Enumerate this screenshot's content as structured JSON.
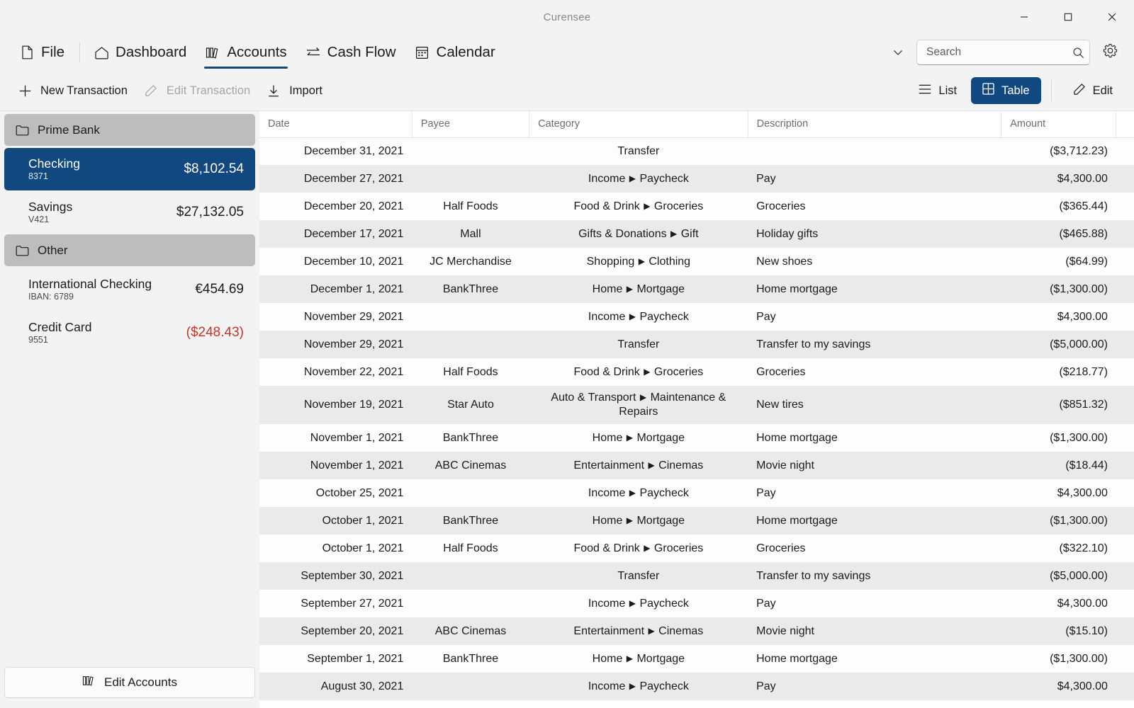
{
  "window": {
    "title": "Curensee",
    "controls": [
      {
        "name": "minimize-button",
        "label": "Minimize"
      },
      {
        "name": "maximize-button",
        "label": "Maximize"
      },
      {
        "name": "close-button",
        "label": "Close"
      }
    ]
  },
  "nav": {
    "items": [
      {
        "label": "File",
        "icon": "file-icon",
        "active": false
      },
      {
        "label": "Dashboard",
        "icon": "home-icon",
        "active": false
      },
      {
        "label": "Accounts",
        "icon": "accounts-icon",
        "active": true
      },
      {
        "label": "Cash Flow",
        "icon": "transfer-icon",
        "active": false
      },
      {
        "label": "Calendar",
        "icon": "calendar-icon",
        "active": false
      }
    ],
    "overflow_label": "More",
    "settings_label": "Settings"
  },
  "search": {
    "placeholder": "Search",
    "value": ""
  },
  "toolbar": {
    "new_transaction": "New Transaction",
    "edit_transaction": "Edit Transaction",
    "import": "Import",
    "list": "List",
    "table": "Table",
    "edit": "Edit"
  },
  "colors": {
    "accent": "#10487f",
    "negative": "#c9342a",
    "group_header_bg": "#bdbdbd",
    "row_alt_bg": "#eaeaea"
  },
  "sidebar": {
    "groups": [
      {
        "name": "Prime Bank",
        "icon": "folder-icon",
        "accounts": [
          {
            "name": "Checking",
            "number": "8371",
            "balance": "$8,102.54",
            "negative": false,
            "selected": true
          },
          {
            "name": "Savings",
            "number": "V421",
            "balance": "$27,132.05",
            "negative": false,
            "selected": false
          }
        ]
      },
      {
        "name": "Other",
        "icon": "folder-icon",
        "accounts": [
          {
            "name": "International Checking",
            "number": "IBAN: 6789",
            "balance": "€454.69",
            "negative": false,
            "selected": false
          },
          {
            "name": "Credit Card",
            "number": "9551",
            "balance": "($248.43)",
            "negative": true,
            "selected": false
          }
        ]
      }
    ],
    "edit_accounts": "Edit Accounts"
  },
  "table": {
    "columns": [
      "Date",
      "Payee",
      "Category",
      "Description",
      "Amount"
    ],
    "rows": [
      {
        "date": "December 31, 2021",
        "payee": "",
        "category": "Transfer",
        "description": "",
        "amount": "($3,712.23)"
      },
      {
        "date": "December 27, 2021",
        "payee": "",
        "category": "Income ▶ Paycheck",
        "description": "Pay",
        "amount": "$4,300.00"
      },
      {
        "date": "December 20, 2021",
        "payee": "Half Foods",
        "category": "Food & Drink ▶ Groceries",
        "description": "Groceries",
        "amount": "($365.44)"
      },
      {
        "date": "December 17, 2021",
        "payee": "Mall",
        "category": "Gifts & Donations ▶ Gift",
        "description": "Holiday gifts",
        "amount": "($465.88)"
      },
      {
        "date": "December 10, 2021",
        "payee": "JC Merchandise",
        "category": "Shopping ▶ Clothing",
        "description": "New shoes",
        "amount": "($64.99)"
      },
      {
        "date": "December 1, 2021",
        "payee": "BankThree",
        "category": "Home ▶ Mortgage",
        "description": "Home mortgage",
        "amount": "($1,300.00)"
      },
      {
        "date": "November 29, 2021",
        "payee": "",
        "category": "Income ▶ Paycheck",
        "description": "Pay",
        "amount": "$4,300.00"
      },
      {
        "date": "November 29, 2021",
        "payee": "",
        "category": "Transfer",
        "description": "Transfer to my savings",
        "amount": "($5,000.00)"
      },
      {
        "date": "November 22, 2021",
        "payee": "Half Foods",
        "category": "Food & Drink ▶ Groceries",
        "description": "Groceries",
        "amount": "($218.77)"
      },
      {
        "date": "November 19, 2021",
        "payee": "Star Auto",
        "category": "Auto & Transport ▶ Maintenance & Repairs",
        "description": "New tires",
        "amount": "($851.32)"
      },
      {
        "date": "November 1, 2021",
        "payee": "BankThree",
        "category": "Home ▶ Mortgage",
        "description": "Home mortgage",
        "amount": "($1,300.00)"
      },
      {
        "date": "November 1, 2021",
        "payee": "ABC Cinemas",
        "category": "Entertainment ▶ Cinemas",
        "description": "Movie night",
        "amount": "($18.44)"
      },
      {
        "date": "October 25, 2021",
        "payee": "",
        "category": "Income ▶ Paycheck",
        "description": "Pay",
        "amount": "$4,300.00"
      },
      {
        "date": "October 1, 2021",
        "payee": "BankThree",
        "category": "Home ▶ Mortgage",
        "description": "Home mortgage",
        "amount": "($1,300.00)"
      },
      {
        "date": "October 1, 2021",
        "payee": "Half Foods",
        "category": "Food & Drink ▶ Groceries",
        "description": "Groceries",
        "amount": "($322.10)"
      },
      {
        "date": "September 30, 2021",
        "payee": "",
        "category": "Transfer",
        "description": "Transfer to my savings",
        "amount": "($5,000.00)"
      },
      {
        "date": "September 27, 2021",
        "payee": "",
        "category": "Income ▶ Paycheck",
        "description": "Pay",
        "amount": "$4,300.00"
      },
      {
        "date": "September 20, 2021",
        "payee": "ABC Cinemas",
        "category": "Entertainment ▶ Cinemas",
        "description": "Movie night",
        "amount": "($15.10)"
      },
      {
        "date": "September 1, 2021",
        "payee": "BankThree",
        "category": "Home ▶ Mortgage",
        "description": "Home mortgage",
        "amount": "($1,300.00)"
      },
      {
        "date": "August 30, 2021",
        "payee": "",
        "category": "Income ▶ Paycheck",
        "description": "Pay",
        "amount": "$4,300.00"
      }
    ]
  }
}
